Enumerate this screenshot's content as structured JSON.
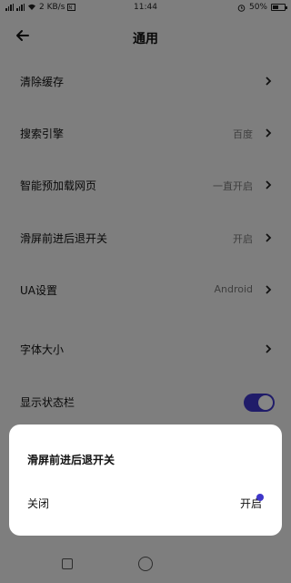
{
  "status_bar": {
    "network": "2 KB/s",
    "time": "11:44",
    "battery": "50%"
  },
  "header": {
    "title": "通用"
  },
  "settings": [
    {
      "label": "清除缓存",
      "value": ""
    },
    {
      "label": "搜索引擎",
      "value": "百度"
    },
    {
      "label": "智能预加载网页",
      "value": "一直开启"
    },
    {
      "label": "滑屏前进后退开关",
      "value": "开启"
    },
    {
      "label": "UA设置",
      "value": "Android"
    },
    {
      "label": "字体大小",
      "value": ""
    },
    {
      "label": "显示状态栏",
      "value": ""
    }
  ],
  "dialog": {
    "title": "滑屏前进后退开关",
    "option_off": "关闭",
    "option_on": "开启",
    "selected": "开启"
  },
  "colors": {
    "accent": "#3f37c9"
  },
  "icons": {
    "back": "back-arrow-icon",
    "chevron": "chevron-right-icon",
    "alarm": "alarm-icon",
    "wifi": "wifi-icon"
  }
}
